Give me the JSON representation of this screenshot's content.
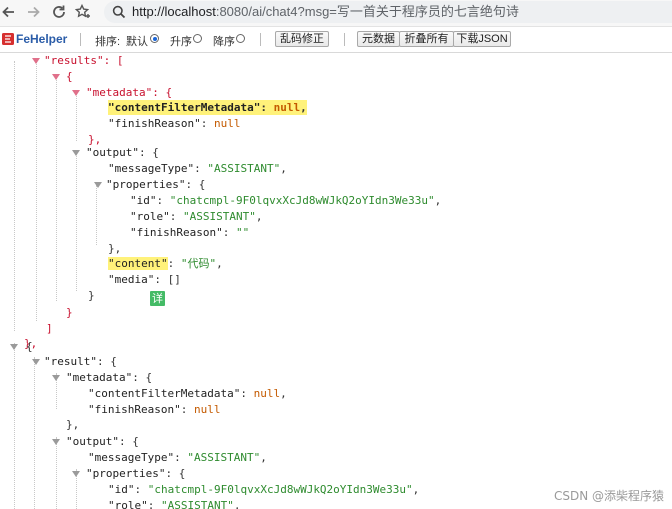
{
  "browser": {
    "url_host": "http://localhost",
    "url_rest": ":8080/ai/chat4?msg=写一首关于程序员的七言绝句诗"
  },
  "toolbar": {
    "title": "FeHelper",
    "sort_label": "排序:",
    "sort_options": [
      "默认",
      "升序",
      "降序"
    ],
    "sort_selected": "默认",
    "fix_button": "乱码修正",
    "buttons": [
      "元数据",
      "折叠所有",
      "下载JSON"
    ]
  },
  "json": {
    "r1": "\"results\"",
    "r2": "\"metadata\"",
    "r3_key": "\"contentFilterMetadata\"",
    "r3_val": "null",
    "r4_key": "\"finishReason\"",
    "r4_val": "null",
    "r6": "\"output\"",
    "r7_key": "\"messageType\"",
    "r7_val": "\"ASSISTANT\"",
    "r8": "\"properties\"",
    "r9_key": "\"id\"",
    "r9_val": "\"chatcmpl-9F0lqvxXcJd8wWJkQ2oYIdn3We33u\"",
    "r10_key": "\"role\"",
    "r10_val": "\"ASSISTANT\"",
    "r11_key": "\"finishReason\"",
    "r11_val": "\"\"",
    "r13_key": "\"content\"",
    "r13_val": "\"代码\"",
    "r14_key": "\"media\"",
    "r14_val": "[]",
    "r19": "\"result\"",
    "r20": "\"metadata\"",
    "r21_key": "\"contentFilterMetadata\"",
    "r21_val": "null",
    "r22_key": "\"finishReason\"",
    "r22_val": "null",
    "r24": "\"output\"",
    "r25_key": "\"messageType\"",
    "r25_val": "\"ASSISTANT\"",
    "r26": "\"properties\"",
    "r27_key": "\"id\"",
    "r27_val": "\"chatcmpl-9F0lqvxXcJd8wWJkQ2oYIdn3We33u\"",
    "r28_key": "\"role\"",
    "r28_val": "\"ASSISTANT\""
  },
  "detail_badge": "详",
  "watermark": "CSDN @添柴程序猿",
  "colors": {
    "key": "#222222",
    "string": "#2e8b2e",
    "null": "#c45a00",
    "highlight": "#fff27a",
    "badge": "#44bb66"
  }
}
